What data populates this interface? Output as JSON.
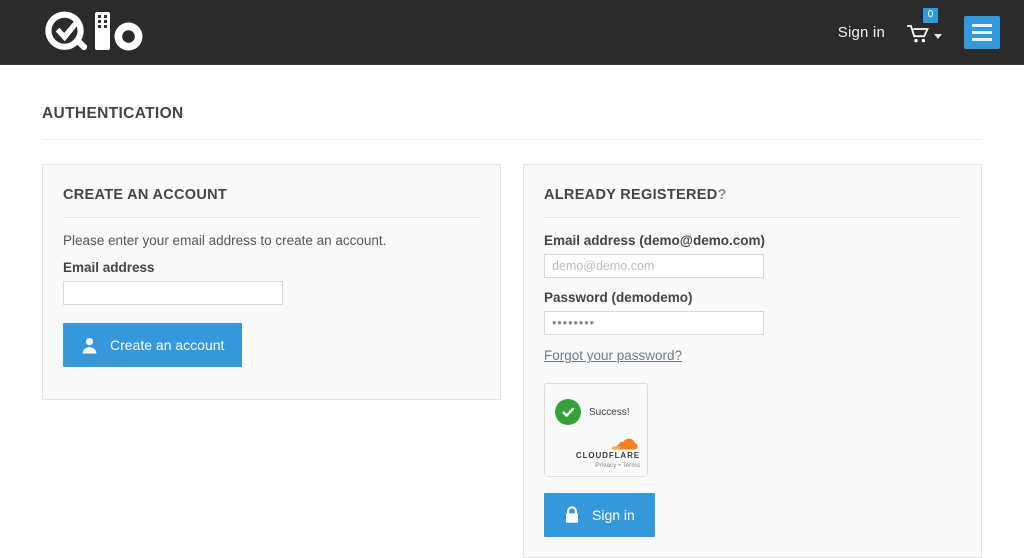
{
  "header": {
    "logo_name": "qlo-logo",
    "signin_label": "Sign in",
    "cart_icon": "shopping-cart-icon",
    "cart_count": "0",
    "menu_icon": "hamburger-menu-icon",
    "accent_color": "#3498db",
    "background_color": "#2b2b2b"
  },
  "page": {
    "title": "AUTHENTICATION"
  },
  "create_account": {
    "panel_title": "CREATE AN ACCOUNT",
    "help_text": "Please enter your email address to create an account.",
    "email_label": "Email address",
    "email_value": "",
    "email_placeholder": "",
    "button_label": "Create an account",
    "button_icon": "user-icon"
  },
  "already_registered": {
    "panel_title_main": "ALREADY REGISTERED",
    "panel_title_mark": "?",
    "email_label": "Email address (demo@demo.com)",
    "email_value": "",
    "email_placeholder": "demo@demo.com",
    "password_label": "Password (demodemo)",
    "password_value": "••••••••",
    "forgot_link": "Forgot your password?",
    "button_label": "Sign in",
    "button_icon": "lock-icon"
  },
  "turnstile": {
    "status_text": "Success!",
    "status_icon": "green-check-circle-icon",
    "brand": "CLOUDFLARE",
    "legal": "Privacy • Terms",
    "brand_icon": "cloudflare-cloud-icon",
    "success_color": "#34a13a",
    "brand_color": "#f6821f"
  }
}
